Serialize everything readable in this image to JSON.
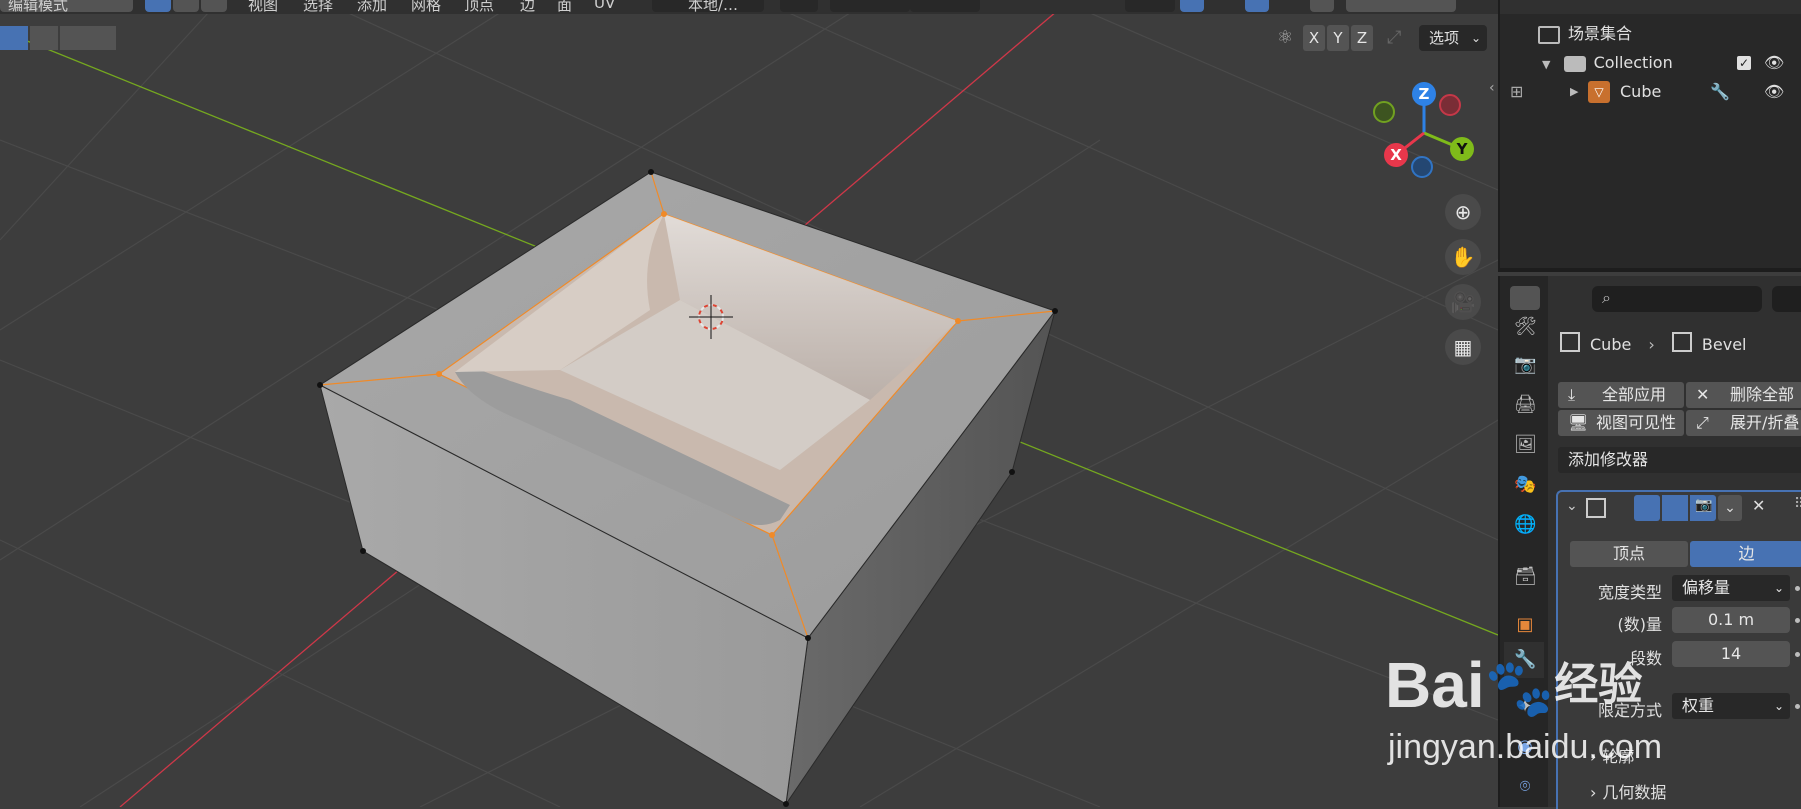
{
  "topbar": {
    "mode_label": "编辑模式",
    "menus": [
      "视图",
      "选择",
      "添加",
      "网格",
      "顶点",
      "边",
      "面",
      "UV"
    ],
    "transform_orientation": "本地/…"
  },
  "viewport": {
    "axis_x": "X",
    "axis_y": "Y",
    "axis_z": "Z",
    "options_label": "选项",
    "gizmo": {
      "x": "X",
      "y": "Y",
      "z": "Z"
    }
  },
  "outliner": {
    "scene_collection": "场景集合",
    "collection": "Collection",
    "object": "Cube"
  },
  "properties": {
    "breadcrumb_object": "Cube",
    "breadcrumb_modifier": "Bevel",
    "apply_all": "全部应用",
    "delete_all": "删除全部",
    "viewport_vis": "视图可见性",
    "expand_collapse": "展开/折叠",
    "add_modifier": "添加修改器",
    "tab_vertices": "顶点",
    "tab_edges": "边",
    "width_type_label": "宽度类型",
    "width_type_value": "偏移量",
    "amount_label": "(数)量",
    "amount_value": "0.1 m",
    "segments_label": "段数",
    "segments_value": "14",
    "limit_method_label": "限定方式",
    "limit_method_value": "权重",
    "profile_label": "轮廓",
    "geometry_label": "几何数据"
  },
  "watermark": {
    "brand": "Bai",
    "brand_cn": "经验",
    "url": "jingyan.baidu.com"
  },
  "colors": {
    "accent": "#4772b3",
    "x_axis": "#e8374b",
    "y_axis": "#7fbb1a",
    "z_axis": "#2e82e6",
    "selection": "#f08a28"
  }
}
